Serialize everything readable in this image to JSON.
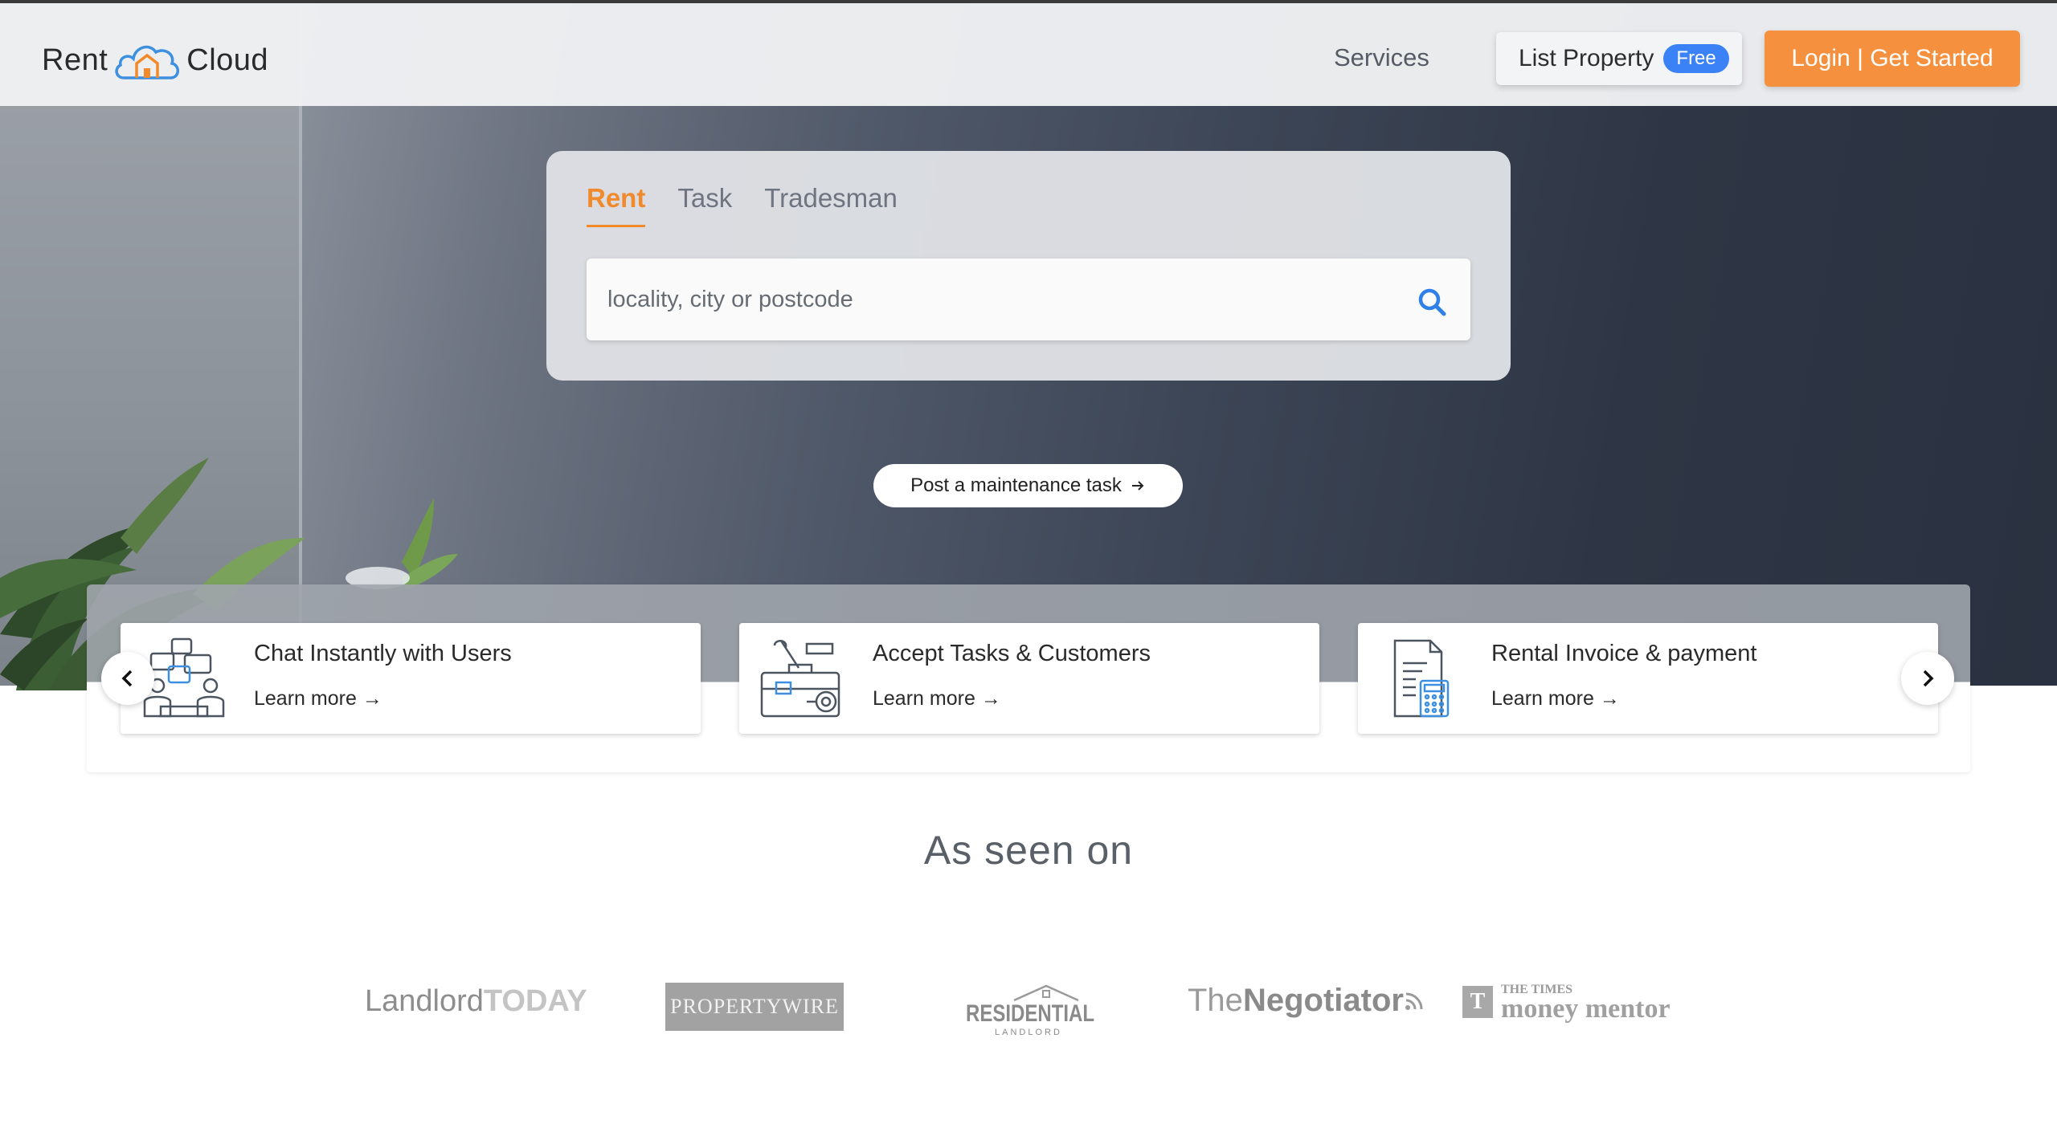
{
  "header": {
    "logo": {
      "left": "Rent",
      "right": "Cloud"
    },
    "nav_services": "Services",
    "list_property": "List Property",
    "free_badge": "Free",
    "login": "Login | Get Started"
  },
  "search": {
    "tabs": [
      "Rent",
      "Task",
      "Tradesman"
    ],
    "active_tab": "Rent",
    "placeholder": "locality, city or postcode"
  },
  "maintenance_button": "Post a maintenance task",
  "features": [
    {
      "title": "Chat Instantly with Users",
      "link": "Learn more",
      "icon": "chat-users-icon"
    },
    {
      "title": "Accept Tasks & Customers",
      "link": "Learn more",
      "icon": "tools-toolbox-icon"
    },
    {
      "title": "Rental Invoice & payment",
      "link": "Learn more",
      "icon": "invoice-calculator-icon"
    }
  ],
  "as_seen_on": {
    "title": "As seen on",
    "press": [
      {
        "part1": "Landlord",
        "part2": "TODAY"
      },
      {
        "part1": "PROPERTY",
        "part2": "WIRE"
      },
      {
        "part1": "RESIDENTIAL",
        "part2": "LANDLORD"
      },
      {
        "part1": "The",
        "part2": "Negotiator"
      },
      {
        "part1": "THE TIMES",
        "part2": "money mentor",
        "mark": "T"
      }
    ]
  },
  "colors": {
    "accent_orange": "#f5913e",
    "badge_blue": "#3b82f6",
    "search_icon_blue": "#2f80e8"
  }
}
